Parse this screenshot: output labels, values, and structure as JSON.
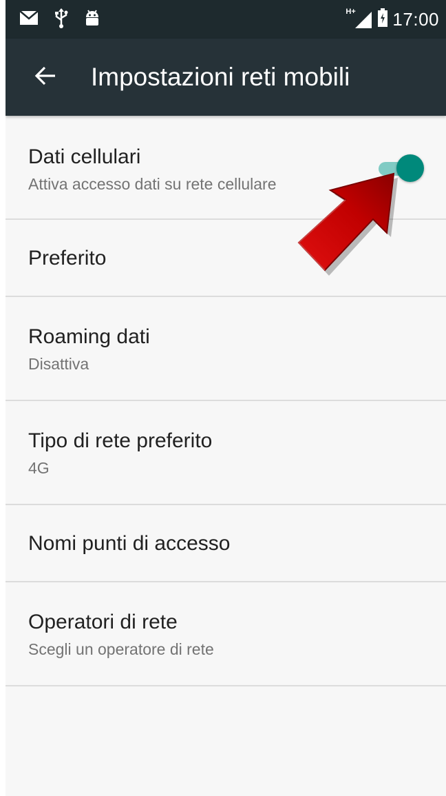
{
  "status_bar": {
    "time": "17:00",
    "network_type": "H+",
    "icons": [
      "mail-icon",
      "usb-icon",
      "android-icon",
      "signal-icon",
      "battery-icon"
    ]
  },
  "app_bar": {
    "title": "Impostazioni reti mobili",
    "back_icon": "back-arrow-icon",
    "background": "#263238"
  },
  "settings": {
    "mobile_data": {
      "title": "Dati cellulari",
      "summary": "Attiva accesso dati su rete cellulare",
      "enabled": true
    },
    "preferred": {
      "title": "Preferito"
    },
    "data_roaming": {
      "title": "Roaming dati",
      "summary": "Disattiva"
    },
    "network_type": {
      "title": "Tipo di rete preferito",
      "summary": "4G"
    },
    "apn": {
      "title": "Nomi punti di accesso"
    },
    "operators": {
      "title": "Operatori di rete",
      "summary": "Scegli un operatore di rete"
    }
  },
  "colors": {
    "accent": "#00897b",
    "accent_track": "#80cbc4",
    "annotation_arrow": "#c40000"
  },
  "annotation": {
    "icon": "red-arrow-pointer-icon"
  }
}
